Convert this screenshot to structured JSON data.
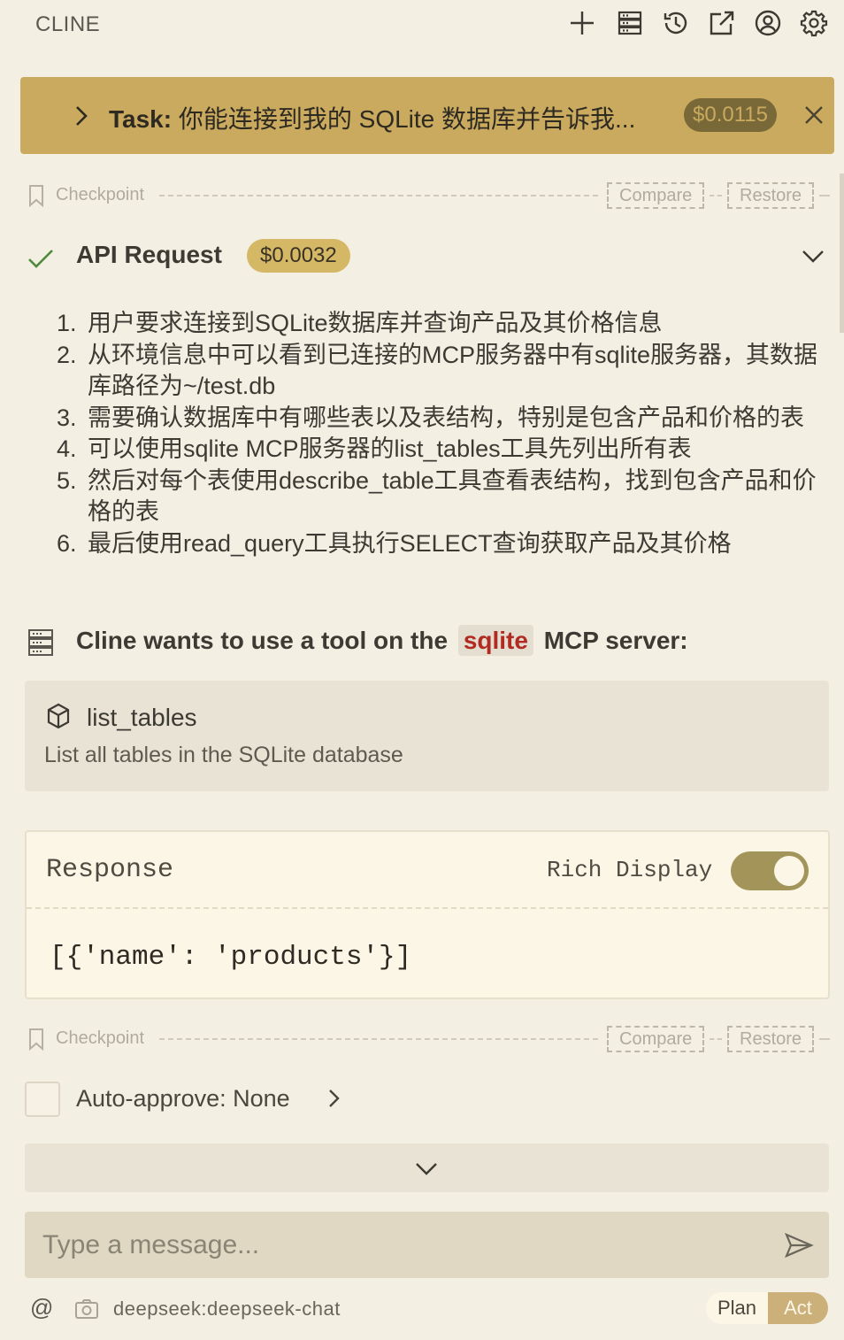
{
  "header": {
    "title": "CLINE",
    "icons": [
      "plus-icon",
      "server-icon",
      "history-icon",
      "external-link-icon",
      "account-icon",
      "settings-icon"
    ]
  },
  "task": {
    "label": "Task:",
    "text": "你能连接到我的 SQLite 数据库并告诉我...",
    "cost": "$0.0115"
  },
  "checkpoint": {
    "label": "Checkpoint",
    "compare": "Compare",
    "restore": "Restore"
  },
  "api_request": {
    "title": "API Request",
    "cost": "$0.0032",
    "steps": [
      {
        "num": "1.",
        "text": "用户要求连接到SQLite数据库并查询产品及其价格信息"
      },
      {
        "num": "2.",
        "text": "从环境信息中可以看到已连接的MCP服务器中有sqlite服务器，其数据库路径为~/test.db"
      },
      {
        "num": "3.",
        "text": "需要确认数据库中有哪些表以及表结构，特别是包含产品和价格的表"
      },
      {
        "num": "4.",
        "text": "可以使用sqlite MCP服务器的list_tables工具先列出所有表"
      },
      {
        "num": "5.",
        "text": "然后对每个表使用describe_table工具查看表结构，找到包含产品和价格的表"
      },
      {
        "num": "6.",
        "text": "最后使用read_query工具执行SELECT查询获取产品及其价格"
      }
    ]
  },
  "tool_use": {
    "prefix": "Cline wants to use a tool on the",
    "server": "sqlite",
    "suffix": "MCP server:",
    "tool_name": "list_tables",
    "tool_desc": "List all tables in the SQLite database"
  },
  "response": {
    "title": "Response",
    "rich_display_label": "Rich Display",
    "rich_display_on": true,
    "content": "[{'name': 'products'}]"
  },
  "auto_approve": {
    "label": "Auto-approve: None"
  },
  "composer": {
    "placeholder": "Type a message...",
    "at_symbol": "@",
    "model": "deepseek:deepseek-chat",
    "mode_plan": "Plan",
    "mode_act": "Act",
    "active_mode": "Act"
  },
  "colors": {
    "background": "#f3efe3",
    "task_banner": "#c9aa5e",
    "cost_pill": "#d5b866",
    "server_chip_text": "#b22b22",
    "toggle_on": "#a3945a",
    "check_green": "#4f8a3c"
  }
}
